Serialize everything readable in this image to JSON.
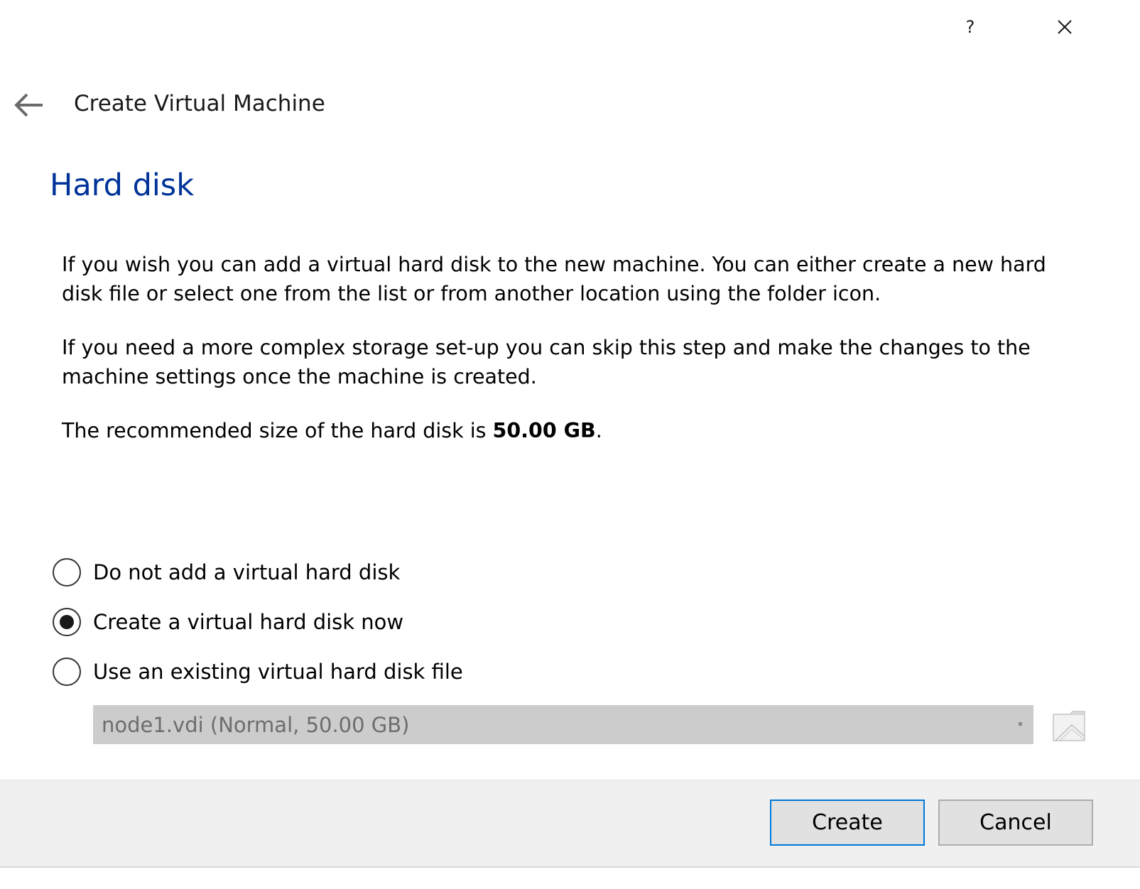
{
  "window": {
    "help_label": "?",
    "close_icon": "close-icon"
  },
  "header": {
    "back_icon": "arrow-left-icon",
    "title": "Create Virtual Machine"
  },
  "page": {
    "heading": "Hard disk",
    "heading_color": "#003399",
    "description_1": "If you wish you can add a virtual hard disk to the new machine. You can either create a new hard disk file or select one from the list or from another location using the folder icon.",
    "description_2": "If you need a more complex storage set-up you can skip this step and make the changes to the machine settings once the machine is created.",
    "recommended_prefix": "The recommended size of the hard disk is ",
    "recommended_size": "50.00 GB",
    "recommended_suffix": "."
  },
  "options": [
    {
      "label": "Do not add a virtual hard disk",
      "selected": false
    },
    {
      "label": "Create a virtual hard disk now",
      "selected": true
    },
    {
      "label": "Use an existing virtual hard disk file",
      "selected": false
    }
  ],
  "existing_disk": {
    "selected_value": "node1.vdi (Normal, 50.00 GB)",
    "enabled": false,
    "folder_icon": "folder-icon"
  },
  "footer": {
    "create_label": "Create",
    "cancel_label": "Cancel",
    "default_button_border": "#0078d7"
  }
}
